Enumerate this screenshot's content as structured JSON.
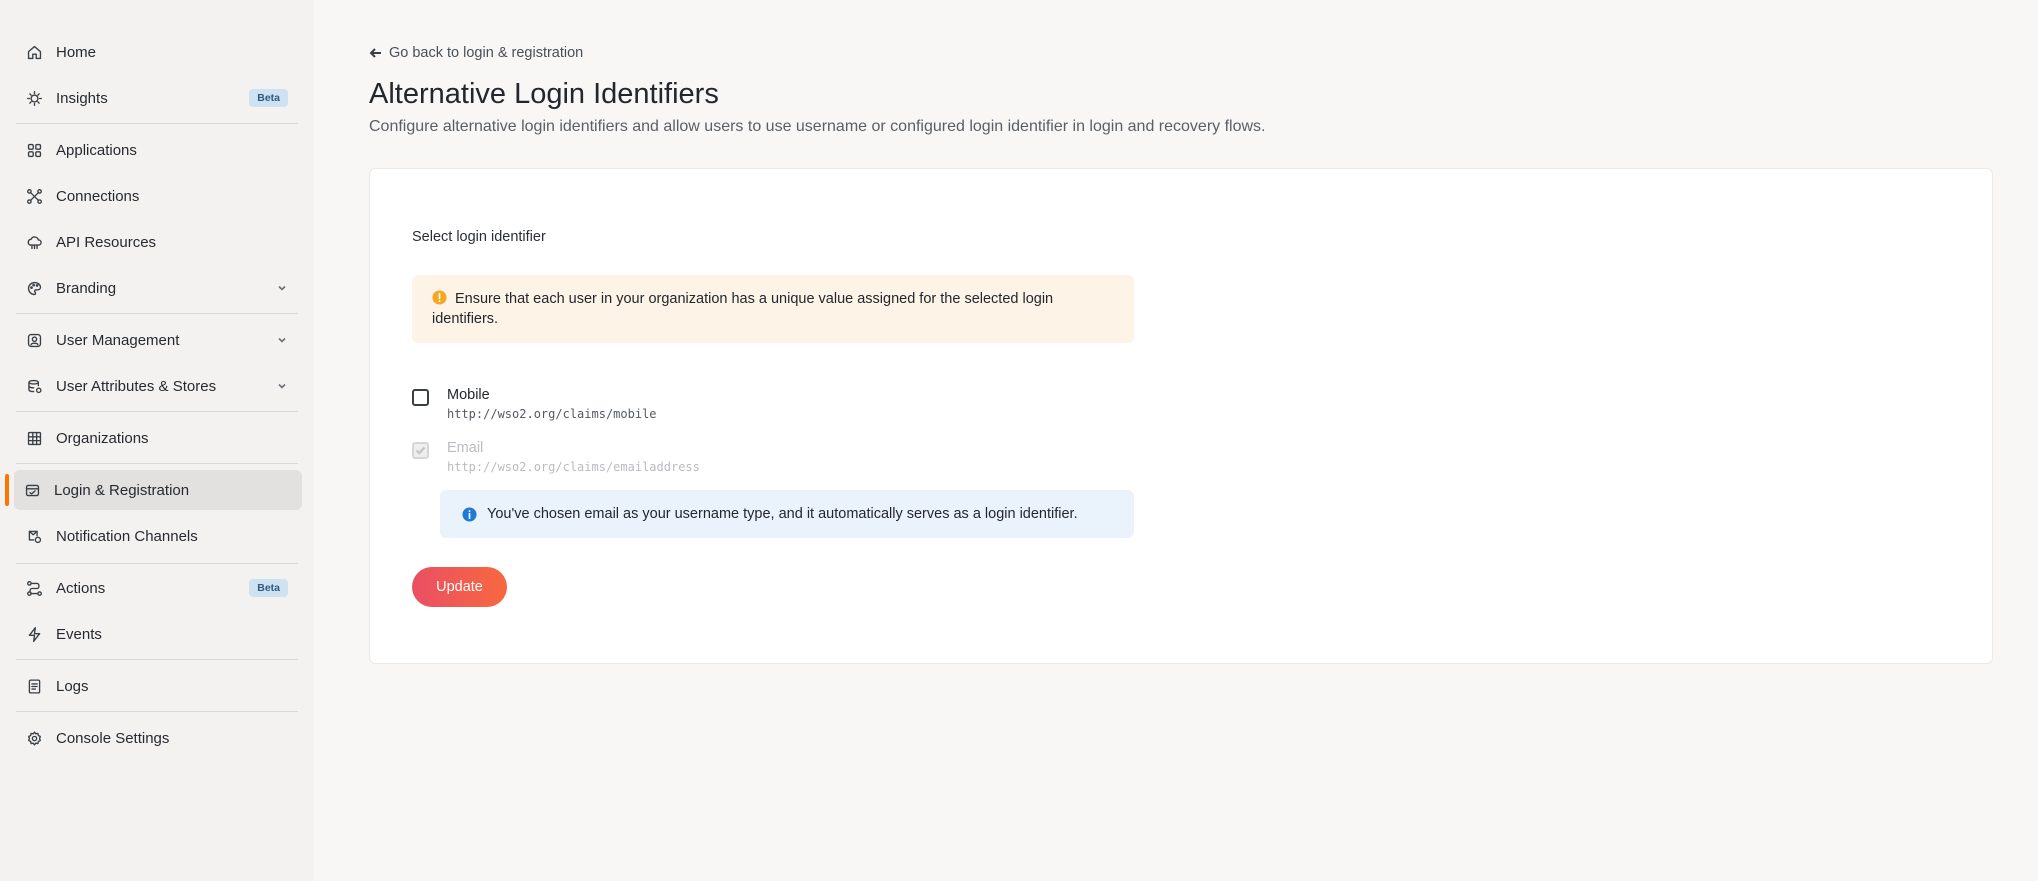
{
  "sidebar": {
    "items": [
      {
        "label": "Home",
        "icon": "home-icon"
      },
      {
        "label": "Insights",
        "icon": "bulb-icon",
        "badge": "Beta"
      },
      {
        "label": "Applications",
        "icon": "grid-icon"
      },
      {
        "label": "Connections",
        "icon": "connections-icon"
      },
      {
        "label": "API Resources",
        "icon": "cloud-icon"
      },
      {
        "label": "Branding",
        "icon": "palette-icon"
      },
      {
        "label": "User Management",
        "icon": "user-icon"
      },
      {
        "label": "User Attributes & Stores",
        "icon": "database-icon"
      },
      {
        "label": "Organizations",
        "icon": "building-icon"
      },
      {
        "label": "Login & Registration",
        "icon": "login-icon"
      },
      {
        "label": "Notification Channels",
        "icon": "notification-icon"
      },
      {
        "label": "Actions",
        "icon": "actions-icon",
        "badge": "Beta"
      },
      {
        "label": "Events",
        "icon": "bolt-icon"
      },
      {
        "label": "Logs",
        "icon": "logs-icon"
      },
      {
        "label": "Console Settings",
        "icon": "settings-icon"
      }
    ]
  },
  "main": {
    "back_link": "Go back to login & registration",
    "title": "Alternative Login Identifiers",
    "description": "Configure alternative login identifiers and allow users to use username or configured login identifier in login and recovery flows.",
    "section_label": "Select login identifier",
    "warning": "Ensure that each user in your organization has a unique value assigned for the selected login identifiers.",
    "options": [
      {
        "label": "Mobile",
        "uri": "http://wso2.org/claims/mobile",
        "checked": false,
        "disabled": false
      },
      {
        "label": "Email",
        "uri": "http://wso2.org/claims/emailaddress",
        "checked": true,
        "disabled": true
      }
    ],
    "info": "You've chosen email as your username type, and it automatically serves as a login identifier.",
    "update_button": "Update"
  },
  "colors": {
    "accent": "#ff7300",
    "button_gradient_start": "#ea4f63",
    "button_gradient_end": "#f7683f",
    "warning_bg": "#fdf3e7",
    "info_bg": "#eaf3fc",
    "badge_bg": "#cfe2f1"
  }
}
